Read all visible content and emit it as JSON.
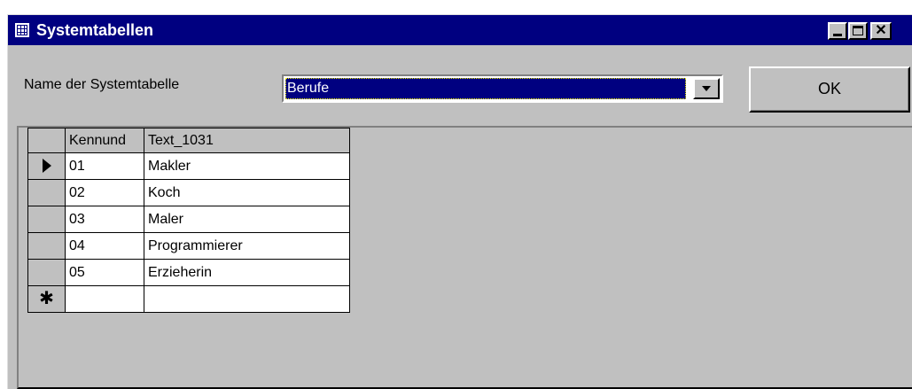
{
  "window": {
    "title": "Systemtabellen"
  },
  "form": {
    "label": "Name der Systemtabelle",
    "selected_table": "Berufe",
    "ok_label": "OK"
  },
  "grid": {
    "columns": [
      "Kennund",
      "Text_1031"
    ],
    "rows": [
      {
        "id": "01",
        "text": "Makler"
      },
      {
        "id": "02",
        "text": "Koch"
      },
      {
        "id": "03",
        "text": "Maler"
      },
      {
        "id": "04",
        "text": "Programmierer"
      },
      {
        "id": "05",
        "text": "Erzieherin"
      }
    ],
    "new_row_marker": "✱"
  },
  "icons": {
    "title": "table-icon",
    "minimize": "minimize-icon",
    "maximize": "maximize-icon",
    "close": "close-icon",
    "dropdown": "chevron-down-icon",
    "current_row": "row-pointer-icon",
    "new_row": "new-record-icon"
  },
  "colors": {
    "titlebar": "#000080",
    "selection": "#000080",
    "face": "#c0c0c0"
  }
}
